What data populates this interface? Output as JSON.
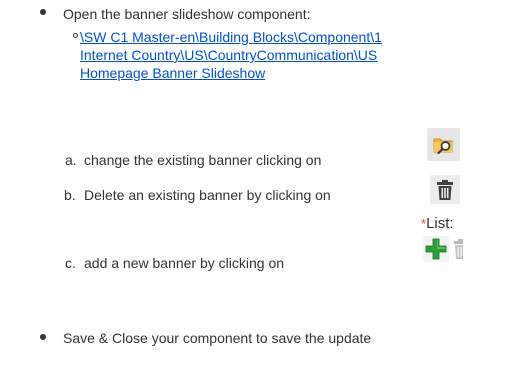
{
  "steps": {
    "open_component": "Open the banner slideshow component:",
    "path_lines": [
      "\\SW C1 Master-en\\Building Blocks\\Component\\1",
      "Internet Country\\US\\CountryCommunication\\US",
      "Homepage Banner Slideshow"
    ],
    "sub_steps": [
      {
        "marker": "a.",
        "text": "change the existing banner clicking on"
      },
      {
        "marker": "b.",
        "text": "Delete an existing banner by clicking on"
      },
      {
        "marker": "c.",
        "text": "add a new banner by clicking on"
      }
    ],
    "save_close": "Save & Close your component to save the update"
  },
  "list_widget": {
    "required_marker": "*",
    "label": "List:"
  },
  "icons": {
    "browse": "folder-search-icon",
    "delete": "trash-icon",
    "add": "plus-icon",
    "delete_disabled": "trash-disabled-icon"
  },
  "colors": {
    "text": "#333333",
    "link": "#0052cc",
    "folder": "#f2b33d",
    "folder_frame": "#e7e7e7",
    "trash": "#3f3f3f",
    "plus": "#2f9e3a",
    "required": "#e0443e"
  }
}
